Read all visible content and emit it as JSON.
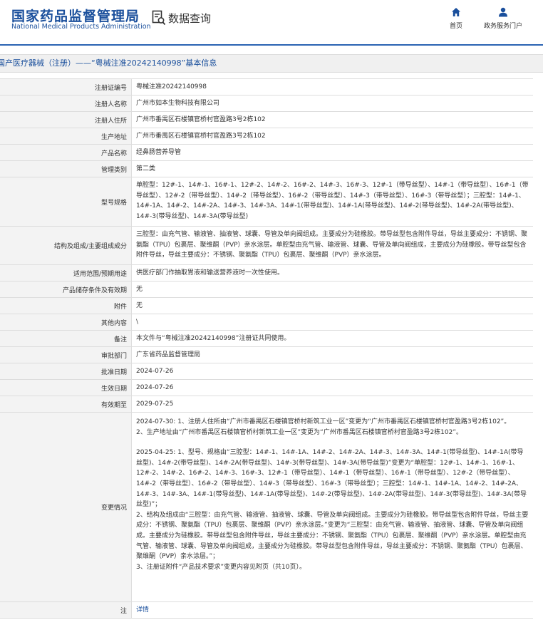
{
  "header": {
    "logo_cn": "国家药品监督管理局",
    "logo_en": "National Medical Products Administration",
    "query_label": "数据查询",
    "nav": {
      "home": "首页",
      "portal": "政务服务门户"
    }
  },
  "title_bar": "国产医疗器械（注册）——“粤械注准20242140998”基本信息",
  "fields": {
    "reg_no": {
      "label": "注册证编号",
      "value": "粤械注准20242140998"
    },
    "registrant": {
      "label": "注册人名称",
      "value": "广州市如本生物科技有限公司"
    },
    "registrant_addr": {
      "label": "注册人住所",
      "value": "广州市番禺区石楼镇官桥村官盈路3号2栋102"
    },
    "prod_addr": {
      "label": "生产地址",
      "value": "广州市番禺区石楼镇官桥村官盈路3号2栋102"
    },
    "product_name": {
      "label": "产品名称",
      "value": "经鼻肠营养导管"
    },
    "category": {
      "label": "管理类别",
      "value": "第二类"
    },
    "model": {
      "label": "型号规格",
      "value": "单腔型：12#-1、14#-1、16#-1、12#-2、14#-2、16#-2、14#-3、16#-3、12#-1（带导丝型）、14#-1（带导丝型）、16#-1（带导丝型）、12#-2（带导丝型）、14#-2（带导丝型）、16#-2（带导丝型）、14#-3（带导丝型）、16#-3（带导丝型）；三腔型：14#-1、14#-1A、14#-2、14#-2A、14#-3、14#-3A、14#-1(带导丝型)、14#-1A(带导丝型)、14#-2(带导丝型)、14#-2A(带导丝型)、14#-3(带导丝型)、14#-3A(带导丝型)"
    },
    "structure": {
      "label": "结构及组成/主要组成成分",
      "value": "三腔型：由充气管、输液管、抽液管、球囊、导管及单向阀组成。主要成分为硅橡胶。带导丝型包含附件导丝，导丝主要成分：不锈钢、聚氨酯（TPU）包裹层、聚维酮（PVP）亲水涂层。单腔型由充气管、输液管、球囊、导管及单向阀组成，主要成分为硅橡胶。带导丝型包含附件导丝，导丝主要成分：不锈钢、聚氨酯（TPU）包裹层、聚维酮（PVP）亲水涂层。"
    },
    "usage": {
      "label": "适用范围/预期用途",
      "value": "供医疗部门作抽取胃液和输送营养液时一次性使用。"
    },
    "storage": {
      "label": "产品储存条件及有效期",
      "value": "无"
    },
    "attachment": {
      "label": "附件",
      "value": "无"
    },
    "other": {
      "label": "其他内容",
      "value": "\\"
    },
    "remark": {
      "label": "备注",
      "value": "本文件与“粤械注准20242140998”注册证共同使用。"
    },
    "dept": {
      "label": "审批部门",
      "value": "广东省药品监督管理局"
    },
    "approve_date": {
      "label": "批准日期",
      "value": "2024-07-26"
    },
    "effective_date": {
      "label": "生效日期",
      "value": "2024-07-26"
    },
    "expire_date": {
      "label": "有效期至",
      "value": "2029-07-25"
    },
    "changes": {
      "label": "变更情况",
      "p1": "2024-07-30: 1、注册人住所由“广州市番禺区石楼镇官桥村新筑工业一区”变更为“广州市番禺区石楼镇官桥村官盈路3号2栋102”。",
      "p2": "2、生产地址由“广州市番禺区石楼镇官桥村新筑工业一区”变更为“广州市番禺区石楼镇官桥村官盈路3号2栋102”。",
      "p3": "2025-04-25: 1、型号、规格由“三腔型：14#-1、14#-1A、14#-2、14#-2A、14#-3、14#-3A、14#-1(带导丝型)、14#-1A(带导丝型)、14#-2(带导丝型)、14#-2A(带导丝型)、14#-3(带导丝型)、14#-3A(带导丝型)”变更为“单腔型：12#-1、14#-1、16#-1、12#-2、14#-2、16#-2、14#-3、16#-3、12#-1（带导丝型）、14#-1（带导丝型）、16#-1（带导丝型）、12#-2（带导丝型）、14#-2（带导丝型）、16#-2（带导丝型）、14#-3（带导丝型）、16#-3（带导丝型）；三腔型：14#-1、14#-1A、14#-2、14#-2A、14#-3、14#-3A、14#-1(带导丝型)、14#-1A(带导丝型)、14#-2(带导丝型)、14#-2A(带导丝型)、14#-3(带导丝型)、14#-3A(带导丝型)”；",
      "p4": "2、结构及组成由“三腔型：由充气管、输液管、抽液管、球囊、导管及单向阀组成。主要成分为硅橡胶。带导丝型包含附件导丝，导丝主要成分：不锈钢、聚氨酯（TPU）包裹层、聚维酮（PVP）亲水涂层。”变更为“三腔型：由充气管、输液管、抽液管、球囊、导管及单向阀组成。主要成分为硅橡胶。带导丝型包含附件导丝，导丝主要成分：不锈钢、聚氨酯（TPU）包裹层、聚维酮（PVP）亲水涂层。单腔型由充气管、输液管、球囊、导管及单向阀组成，主要成分为硅橡胶。带导丝型包含附件导丝，导丝主要成分：不锈钢、聚氨酯（TPU）包裹层、聚维酮（PVP）亲水涂层。”；",
      "p5": "3、注册证附件“产品技术要求”变更内容见附页（共10页）。"
    },
    "note": {
      "label": "注",
      "value": "详情"
    }
  },
  "colors": {
    "brand_blue": "#1a4f9c",
    "rule_blue": "#2b63b3",
    "label_bg": "#f3f3f3",
    "border": "#dddddd"
  },
  "icons": {
    "query": "document-search-icon",
    "home": "home-icon",
    "portal": "user-icon"
  }
}
